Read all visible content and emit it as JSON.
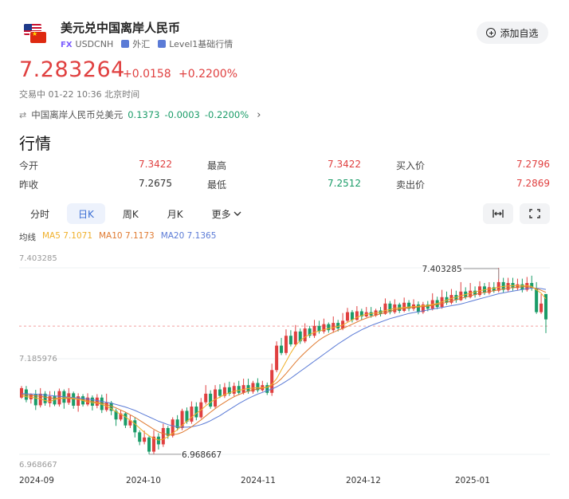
{
  "header": {
    "title": "美元兑中国离岸人民币",
    "fx_badge": "FX",
    "symbol": "USDCNH",
    "market": "外汇",
    "level": "Level1基础行情",
    "watchlist_label": "添加自选"
  },
  "quote": {
    "price": "7.283264",
    "change": "+0.0158",
    "change_pct": "+0.2200%",
    "status": "交易中 01-22 10:36 北京时间"
  },
  "related": {
    "name": "中国离岸人民币兑美元",
    "price": "0.1373",
    "change": "-0.0003",
    "change_pct": "-0.2200%"
  },
  "section_title": "行情",
  "stats": {
    "open_label": "今开",
    "open": "7.3422",
    "high_label": "最高",
    "high": "7.3422",
    "bid_label": "买入价",
    "bid": "7.2796",
    "prev_close_label": "昨收",
    "prev_close": "7.2675",
    "low_label": "最低",
    "low": "7.2512",
    "ask_label": "卖出价",
    "ask": "7.2869"
  },
  "tabs": [
    "分时",
    "日K",
    "周K",
    "月K",
    "更多"
  ],
  "active_tab": "日K",
  "ma_legend": {
    "label": "均线",
    "ma5": "MA5 7.1071",
    "ma10": "MA10 7.1173",
    "ma20": "MA20 7.1365"
  },
  "colors": {
    "up": "#e04040",
    "down": "#1a9c68",
    "ma5": "#f0b02a",
    "ma10": "#e07a30",
    "ma20": "#5b7bd6",
    "accent": "#3b6fd4"
  },
  "chart_data": {
    "type": "candlestick",
    "y_tick_labels": [
      "7.403285",
      "7.185976",
      "6.968667"
    ],
    "ylim": [
      6.968667,
      7.403285
    ],
    "x_tick_labels": [
      "2024-09",
      "2024-10",
      "2024-11",
      "2024-12",
      "2025-01"
    ],
    "max_label": "7.403285",
    "min_label": "6.968667",
    "last_close": 7.2675,
    "candles": [
      [
        7.101,
        7.123,
        7.128,
        7.098
      ],
      [
        7.12,
        7.096,
        7.128,
        7.09
      ],
      [
        7.097,
        7.108,
        7.111,
        7.087
      ],
      [
        7.108,
        7.083,
        7.119,
        7.072
      ],
      [
        7.083,
        7.11,
        7.123,
        7.078
      ],
      [
        7.11,
        7.088,
        7.116,
        7.082
      ],
      [
        7.088,
        7.104,
        7.116,
        7.079
      ],
      [
        7.104,
        7.085,
        7.116,
        7.081
      ],
      [
        7.085,
        7.116,
        7.122,
        7.08
      ],
      [
        7.116,
        7.089,
        7.12,
        7.075
      ],
      [
        7.089,
        7.111,
        7.123,
        7.084
      ],
      [
        7.111,
        7.082,
        7.115,
        7.075
      ],
      [
        7.082,
        7.104,
        7.111,
        7.068
      ],
      [
        7.104,
        7.085,
        7.109,
        7.08
      ],
      [
        7.085,
        7.101,
        7.111,
        7.081
      ],
      [
        7.101,
        7.082,
        7.106,
        7.071
      ],
      [
        7.082,
        7.101,
        7.109,
        7.076
      ],
      [
        7.101,
        7.072,
        7.108,
        7.065
      ],
      [
        7.072,
        7.089,
        7.11,
        7.068
      ],
      [
        7.089,
        7.07,
        7.093,
        7.06
      ],
      [
        7.07,
        7.05,
        7.075,
        7.035
      ],
      [
        7.05,
        7.064,
        7.072,
        7.046
      ],
      [
        7.064,
        7.036,
        7.068,
        7.03
      ],
      [
        7.036,
        7.048,
        7.06,
        7.03
      ],
      [
        7.048,
        7.02,
        7.054,
        7.008
      ],
      [
        7.02,
        6.998,
        7.025,
        6.99
      ],
      [
        6.998,
        7.008,
        7.024,
        6.992
      ],
      [
        7.008,
        6.975,
        7.012,
        6.969
      ],
      [
        6.975,
        7.01,
        7.025,
        6.969
      ],
      [
        7.01,
        6.992,
        7.018,
        6.98
      ],
      [
        6.992,
        7.03,
        7.04,
        6.986
      ],
      [
        7.03,
        7.012,
        7.035,
        7.005
      ],
      [
        7.012,
        7.05,
        7.055,
        7.008
      ],
      [
        7.05,
        7.03,
        7.06,
        7.024
      ],
      [
        7.03,
        7.07,
        7.075,
        7.025
      ],
      [
        7.07,
        7.045,
        7.078,
        7.04
      ],
      [
        7.045,
        7.08,
        7.092,
        7.04
      ],
      [
        7.08,
        7.055,
        7.09,
        7.048
      ],
      [
        7.055,
        7.09,
        7.1,
        7.052
      ],
      [
        7.09,
        7.11,
        7.13,
        7.085
      ],
      [
        7.11,
        7.08,
        7.118,
        7.075
      ],
      [
        7.08,
        7.12,
        7.13,
        7.076
      ],
      [
        7.12,
        7.105,
        7.132,
        7.1
      ],
      [
        7.105,
        7.125,
        7.135,
        7.1
      ],
      [
        7.125,
        7.11,
        7.138,
        7.105
      ],
      [
        7.11,
        7.128,
        7.136,
        7.104
      ],
      [
        7.128,
        7.112,
        7.14,
        7.107
      ],
      [
        7.112,
        7.13,
        7.145,
        7.108
      ],
      [
        7.13,
        7.115,
        7.145,
        7.11
      ],
      [
        7.115,
        7.135,
        7.14,
        7.11
      ],
      [
        7.135,
        7.118,
        7.146,
        7.113
      ],
      [
        7.118,
        7.13,
        7.14,
        7.115
      ],
      [
        7.13,
        7.112,
        7.136,
        7.107
      ],
      [
        7.112,
        7.165,
        7.18,
        7.105
      ],
      [
        7.165,
        7.222,
        7.232,
        7.16
      ],
      [
        7.222,
        7.205,
        7.24,
        7.2
      ],
      [
        7.205,
        7.245,
        7.26,
        7.2
      ],
      [
        7.245,
        7.225,
        7.258,
        7.22
      ],
      [
        7.225,
        7.255,
        7.27,
        7.22
      ],
      [
        7.255,
        7.232,
        7.262,
        7.226
      ],
      [
        7.232,
        7.262,
        7.274,
        7.228
      ],
      [
        7.262,
        7.245,
        7.268,
        7.24
      ],
      [
        7.245,
        7.268,
        7.282,
        7.24
      ],
      [
        7.268,
        7.255,
        7.28,
        7.25
      ],
      [
        7.255,
        7.272,
        7.285,
        7.25
      ],
      [
        7.272,
        7.258,
        7.276,
        7.252
      ],
      [
        7.258,
        7.275,
        7.29,
        7.252
      ],
      [
        7.275,
        7.262,
        7.282,
        7.255
      ],
      [
        7.262,
        7.28,
        7.298,
        7.258
      ],
      [
        7.28,
        7.3,
        7.31,
        7.276
      ],
      [
        7.3,
        7.282,
        7.305,
        7.276
      ],
      [
        7.282,
        7.302,
        7.314,
        7.28
      ],
      [
        7.302,
        7.29,
        7.308,
        7.282
      ],
      [
        7.29,
        7.3,
        7.312,
        7.288
      ],
      [
        7.3,
        7.292,
        7.312,
        7.287
      ],
      [
        7.292,
        7.304,
        7.308,
        7.289
      ],
      [
        7.304,
        7.296,
        7.312,
        7.29
      ],
      [
        7.296,
        7.32,
        7.332,
        7.294
      ],
      [
        7.32,
        7.3,
        7.326,
        7.295
      ],
      [
        7.3,
        7.318,
        7.33,
        7.296
      ],
      [
        7.318,
        7.303,
        7.322,
        7.298
      ],
      [
        7.303,
        7.322,
        7.334,
        7.3
      ],
      [
        7.322,
        7.308,
        7.328,
        7.302
      ],
      [
        7.308,
        7.318,
        7.33,
        7.303
      ],
      [
        7.318,
        7.3,
        7.325,
        7.295
      ],
      [
        7.3,
        7.318,
        7.324,
        7.296
      ],
      [
        7.318,
        7.308,
        7.326,
        7.302
      ],
      [
        7.308,
        7.328,
        7.344,
        7.304
      ],
      [
        7.328,
        7.312,
        7.336,
        7.307
      ],
      [
        7.312,
        7.335,
        7.352,
        7.308
      ],
      [
        7.335,
        7.322,
        7.348,
        7.317
      ],
      [
        7.322,
        7.34,
        7.354,
        7.318
      ],
      [
        7.34,
        7.328,
        7.35,
        7.322
      ],
      [
        7.328,
        7.348,
        7.37,
        7.326
      ],
      [
        7.348,
        7.335,
        7.358,
        7.33
      ],
      [
        7.335,
        7.35,
        7.368,
        7.332
      ],
      [
        7.35,
        7.34,
        7.36,
        7.334
      ],
      [
        7.34,
        7.36,
        7.372,
        7.336
      ],
      [
        7.36,
        7.345,
        7.368,
        7.34
      ],
      [
        7.345,
        7.358,
        7.37,
        7.341
      ],
      [
        7.358,
        7.35,
        7.37,
        7.345
      ],
      [
        7.35,
        7.37,
        7.403285,
        7.346
      ],
      [
        7.37,
        7.352,
        7.38,
        7.346
      ],
      [
        7.352,
        7.368,
        7.38,
        7.348
      ],
      [
        7.368,
        7.356,
        7.38,
        7.35
      ],
      [
        7.356,
        7.365,
        7.378,
        7.351
      ],
      [
        7.365,
        7.352,
        7.378,
        7.346
      ],
      [
        7.352,
        7.368,
        7.382,
        7.348
      ],
      [
        7.368,
        7.356,
        7.385,
        7.35
      ],
      [
        7.356,
        7.3,
        7.37,
        7.296
      ],
      [
        7.3,
        7.32,
        7.342,
        7.296
      ],
      [
        7.3422,
        7.2832,
        7.3422,
        7.2512
      ]
    ],
    "ma5": [
      7.105,
      7.103,
      7.102,
      7.1,
      7.098,
      7.094,
      7.092,
      7.096,
      7.099,
      7.1,
      7.101,
      7.099,
      7.097,
      7.094,
      7.091,
      7.089,
      7.088,
      7.085,
      7.081,
      7.075,
      7.068,
      7.062,
      7.056,
      7.048,
      7.04,
      7.03,
      7.02,
      7.012,
      7.006,
      7.002,
      7.004,
      7.01,
      7.018,
      7.026,
      7.036,
      7.046,
      7.055,
      7.064,
      7.072,
      7.082,
      7.09,
      7.097,
      7.102,
      7.108,
      7.112,
      7.116,
      7.118,
      7.12,
      7.122,
      7.123,
      7.124,
      7.124,
      7.125,
      7.132,
      7.145,
      7.165,
      7.185,
      7.205,
      7.222,
      7.234,
      7.242,
      7.248,
      7.253,
      7.256,
      7.259,
      7.262,
      7.264,
      7.267,
      7.27,
      7.276,
      7.282,
      7.288,
      7.292,
      7.295,
      7.297,
      7.298,
      7.3,
      7.304,
      7.306,
      7.309,
      7.31,
      7.311,
      7.312,
      7.313,
      7.314,
      7.315,
      7.316,
      7.318,
      7.32,
      7.324,
      7.328,
      7.332,
      7.335,
      7.338,
      7.341,
      7.344,
      7.347,
      7.35,
      7.352,
      7.354,
      7.356,
      7.358,
      7.36,
      7.361,
      7.362,
      7.362,
      7.362,
      7.362,
      7.36,
      7.352,
      7.344,
      7.331
    ],
    "ma10": [
      7.108,
      7.107,
      7.106,
      7.105,
      7.104,
      7.102,
      7.1,
      7.099,
      7.099,
      7.099,
      7.099,
      7.098,
      7.097,
      7.096,
      7.094,
      7.092,
      7.09,
      7.088,
      7.085,
      7.081,
      7.077,
      7.072,
      7.067,
      7.061,
      7.055,
      7.048,
      7.041,
      7.034,
      7.027,
      7.021,
      7.017,
      7.015,
      7.015,
      7.016,
      7.02,
      7.026,
      7.033,
      7.041,
      7.049,
      7.058,
      7.067,
      7.075,
      7.083,
      7.09,
      7.097,
      7.103,
      7.108,
      7.112,
      7.116,
      7.119,
      7.121,
      7.123,
      7.125,
      7.129,
      7.135,
      7.145,
      7.157,
      7.17,
      7.183,
      7.195,
      7.206,
      7.216,
      7.226,
      7.235,
      7.242,
      7.248,
      7.253,
      7.258,
      7.262,
      7.267,
      7.272,
      7.277,
      7.282,
      7.286,
      7.29,
      7.293,
      7.296,
      7.299,
      7.302,
      7.305,
      7.307,
      7.309,
      7.31,
      7.311,
      7.312,
      7.313,
      7.314,
      7.316,
      7.318,
      7.32,
      7.323,
      7.326,
      7.329,
      7.332,
      7.335,
      7.338,
      7.341,
      7.344,
      7.346,
      7.348,
      7.35,
      7.352,
      7.354,
      7.356,
      7.357,
      7.358,
      7.359,
      7.359,
      7.358,
      7.355,
      7.351,
      7.346
    ],
    "ma20": [
      7.11,
      7.11,
      7.109,
      7.109,
      7.108,
      7.107,
      7.106,
      7.105,
      7.104,
      7.103,
      7.102,
      7.101,
      7.1,
      7.099,
      7.098,
      7.096,
      7.094,
      7.092,
      7.09,
      7.088,
      7.085,
      7.082,
      7.079,
      7.075,
      7.071,
      7.066,
      7.061,
      7.056,
      7.051,
      7.046,
      7.042,
      7.038,
      7.035,
      7.033,
      7.032,
      7.032,
      7.033,
      7.035,
      7.038,
      7.042,
      7.047,
      7.053,
      7.059,
      7.066,
      7.073,
      7.08,
      7.087,
      7.093,
      7.099,
      7.104,
      7.109,
      7.113,
      7.117,
      7.121,
      7.126,
      7.132,
      7.139,
      7.146,
      7.154,
      7.162,
      7.17,
      7.178,
      7.186,
      7.194,
      7.202,
      7.21,
      7.218,
      7.226,
      7.233,
      7.24,
      7.247,
      7.253,
      7.259,
      7.264,
      7.269,
      7.273,
      7.277,
      7.281,
      7.285,
      7.288,
      7.291,
      7.294,
      7.297,
      7.299,
      7.301,
      7.303,
      7.305,
      7.307,
      7.309,
      7.311,
      7.313,
      7.315,
      7.317,
      7.319,
      7.322,
      7.325,
      7.328,
      7.331,
      7.334,
      7.337,
      7.34,
      7.343,
      7.345,
      7.347,
      7.349,
      7.351,
      7.353,
      7.355,
      7.356,
      7.356,
      7.355,
      7.353
    ]
  }
}
